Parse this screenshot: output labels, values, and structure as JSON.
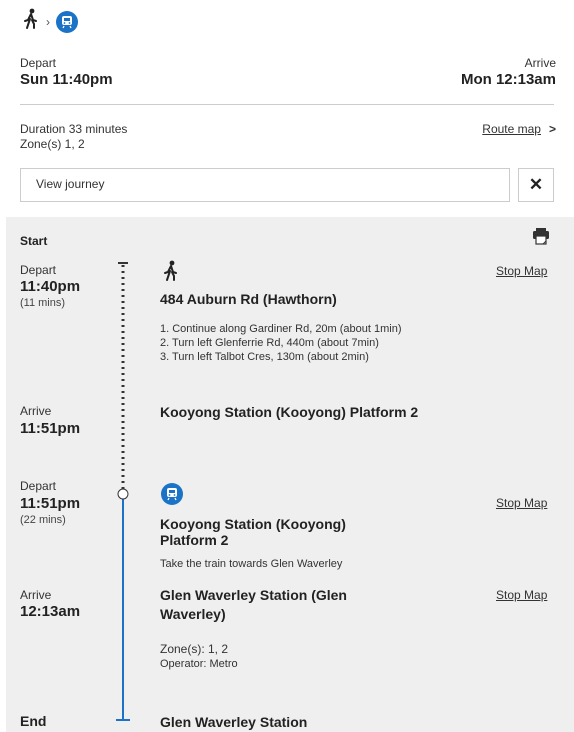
{
  "header": {
    "mode_icons": [
      "walk-icon",
      "chevron-right-icon",
      "train-icon"
    ],
    "depart_label": "Depart",
    "depart_time": "Sun 11:40pm",
    "arrive_label": "Arrive",
    "arrive_time": "Mon 12:13am",
    "duration": "Duration 33 minutes",
    "zones": "Zone(s) 1, 2",
    "route_map_label": "Route map",
    "route_map_chevron": ">",
    "view_journey_label": "View journey",
    "close_label": "✕"
  },
  "journey": {
    "start_label": "Start",
    "print_icon": "print-icon",
    "end_label": "End",
    "legs": [
      {
        "depart_label": "Depart",
        "depart_time": "11:40pm",
        "duration": "(11 mins)",
        "mode_icon": "walk-icon",
        "stop_map_label": "Stop Map",
        "from_title": "484 Auburn Rd (Hawthorn)",
        "instructions": [
          "1. Continue along Gardiner Rd, 20m (about 1min)",
          "2. Turn left Glenferrie Rd, 440m (about 7min)",
          "3. Turn left Talbot Cres, 130m (about 2min)"
        ],
        "arrive_label": "Arrive",
        "arrive_time": "11:51pm",
        "to_title": "Kooyong Station (Kooyong) Platform 2"
      },
      {
        "depart_label": "Depart",
        "depart_time": "11:51pm",
        "duration": "(22 mins)",
        "mode_icon": "train-icon",
        "stop_map_label": "Stop Map",
        "from_title_line1": "Kooyong Station (Kooyong)",
        "from_title_line2": "Platform 2",
        "direction": "Take the train towards Glen Waverley",
        "arrive_label": "Arrive",
        "arrive_time": "12:13am",
        "to_title_line1": "Glen Waverley Station (Glen",
        "to_title_line2": "Waverley)",
        "to_stop_map_label": "Stop Map",
        "zones": "Zone(s): 1, 2",
        "operator": "Operator: Metro"
      }
    ],
    "end_title": "Glen Waverley Station"
  },
  "colors": {
    "accent": "#1a73c7",
    "panel_bg": "#efefef"
  }
}
